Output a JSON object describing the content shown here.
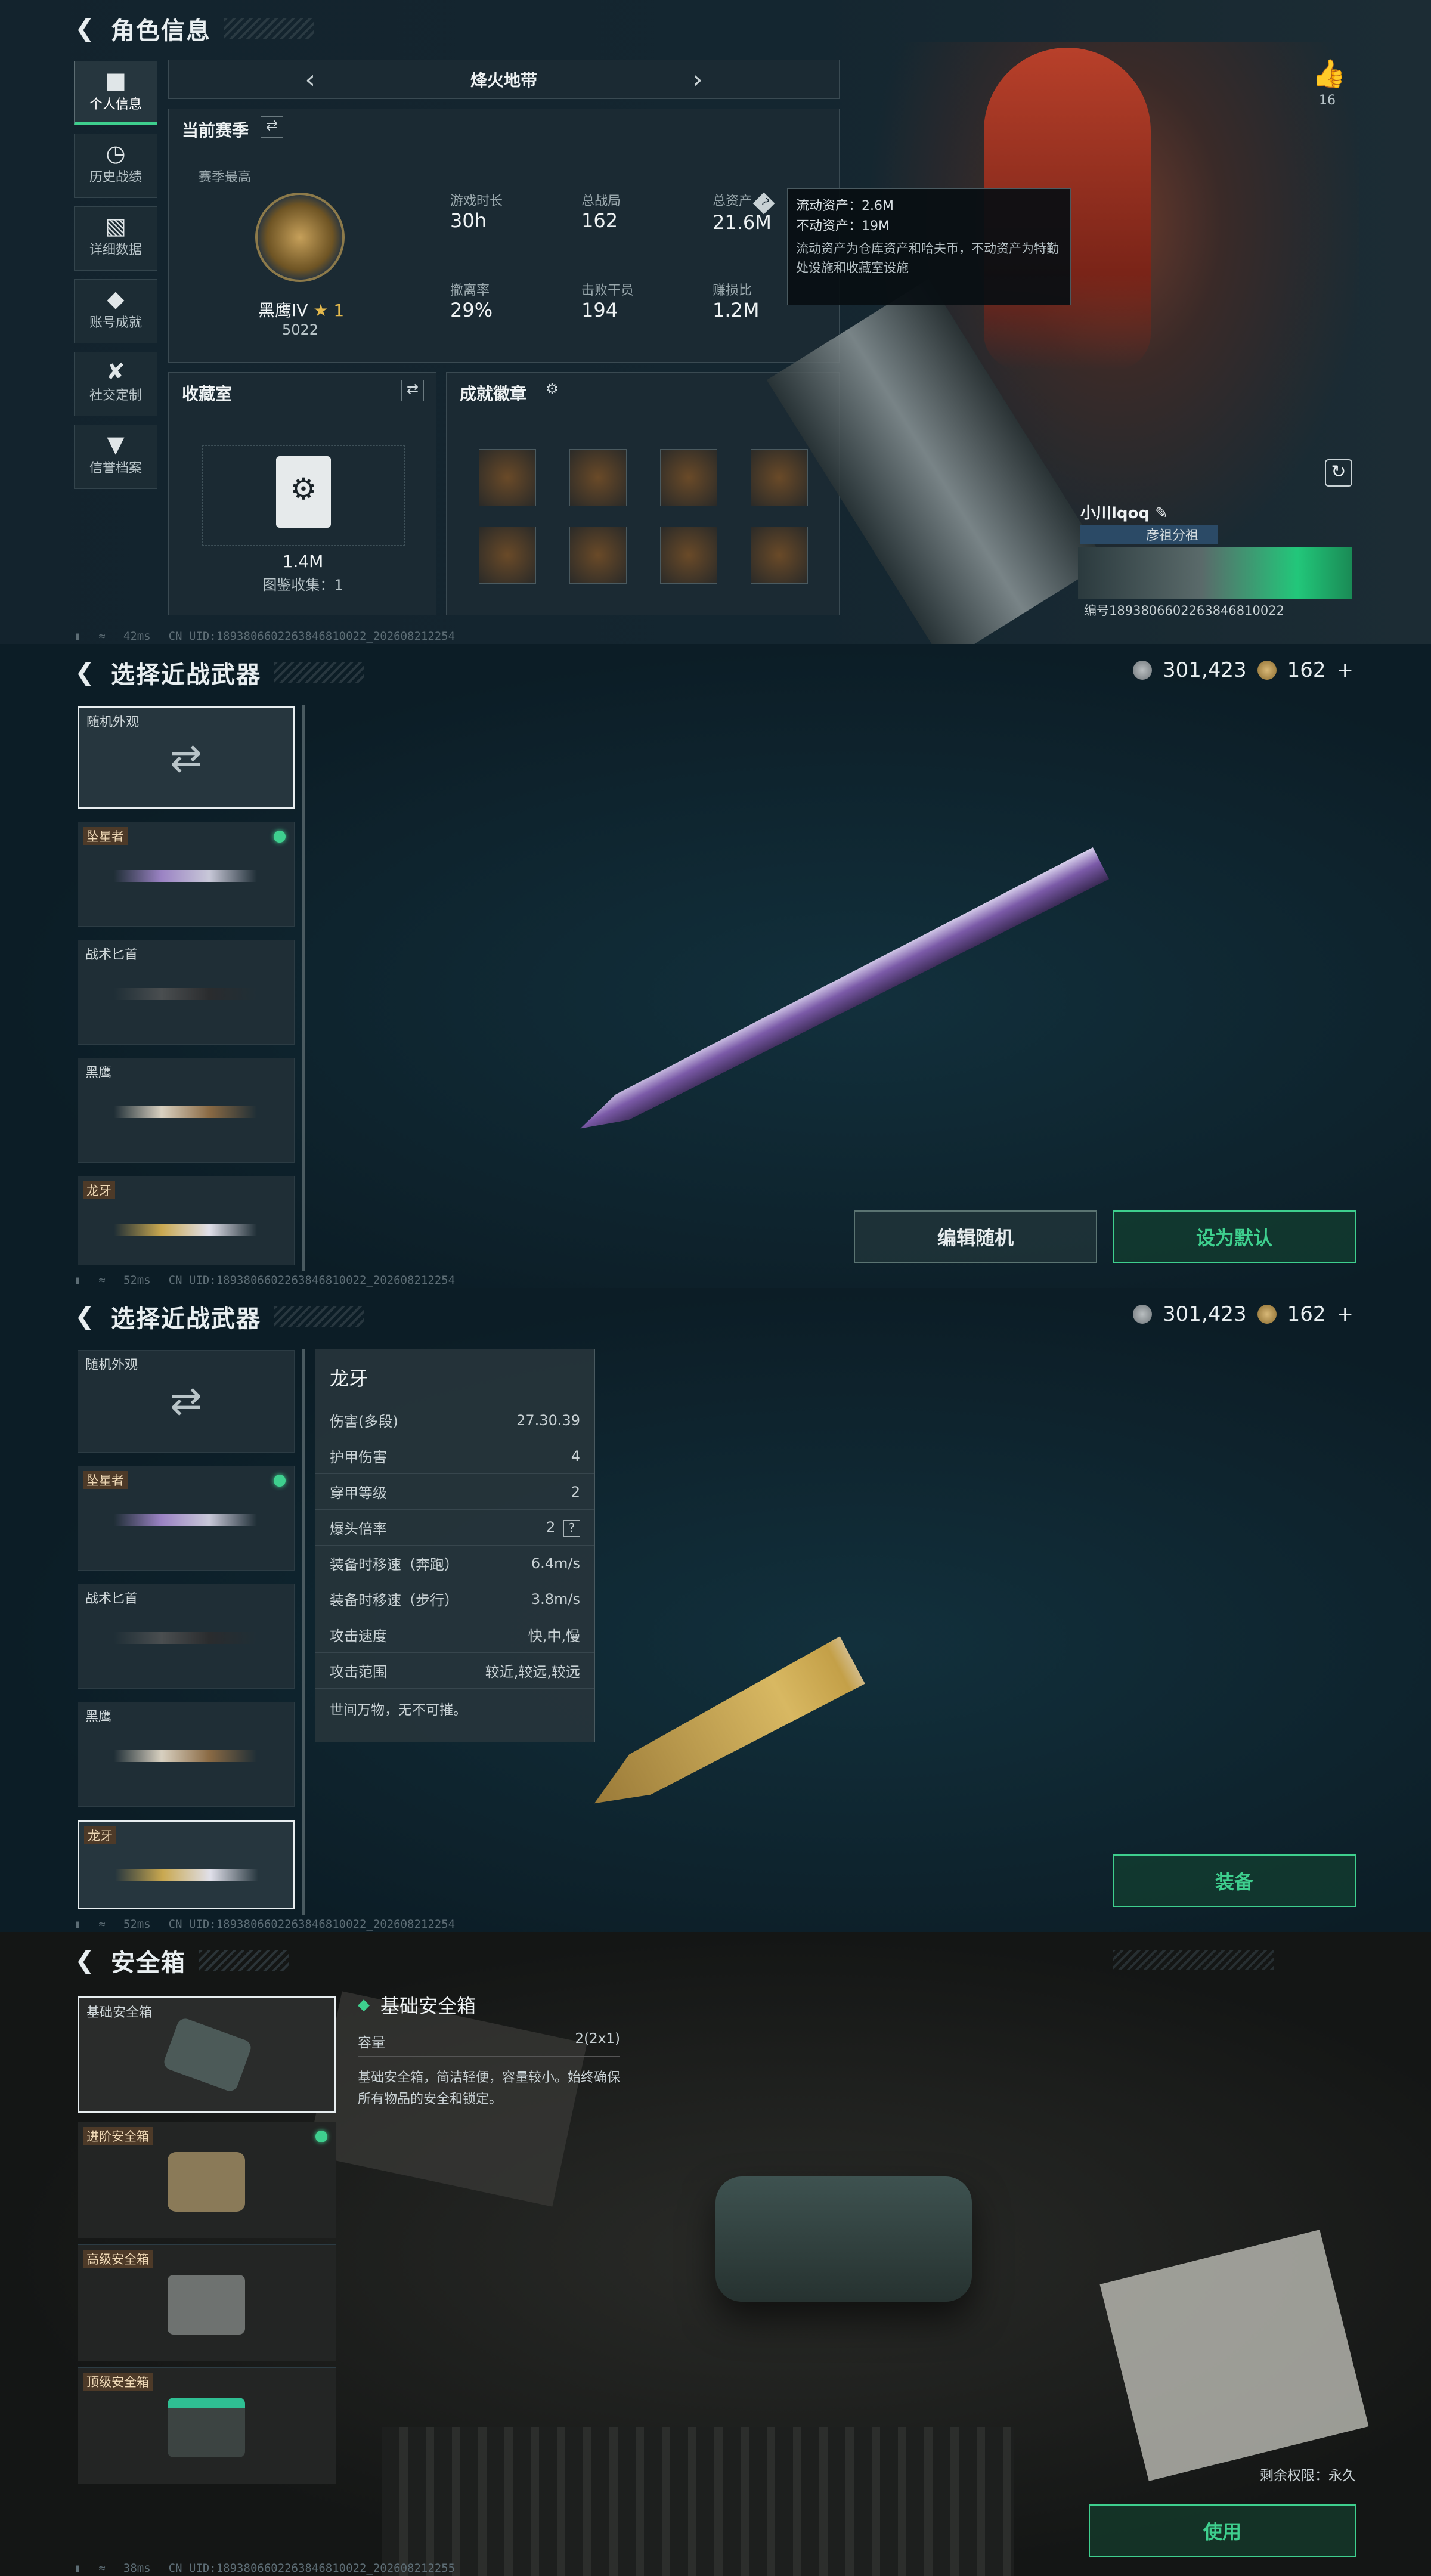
{
  "p1": {
    "title": "角色信息",
    "sidebar": [
      {
        "icon": "bar-chart-icon",
        "label": "个人信息"
      },
      {
        "icon": "history-icon",
        "label": "历史战绩"
      },
      {
        "icon": "folder-icon",
        "label": "详细数据"
      },
      {
        "icon": "trophy-icon",
        "label": "账号成就"
      },
      {
        "icon": "wrench-icon",
        "label": "社交定制"
      },
      {
        "icon": "shield-icon",
        "label": "信誉档案"
      }
    ],
    "map": "烽火地带",
    "season_label": "当前赛季",
    "season_best": "赛季最高",
    "rank_name": "黑鹰IV",
    "rank_stars": "★ 1",
    "rank_points": "5022",
    "stats": [
      {
        "label": "游戏时长",
        "value": "30h"
      },
      {
        "label": "总战局",
        "value": "162"
      },
      {
        "label": "总资产",
        "value": "21.6M"
      },
      {
        "label": "撤离率",
        "value": "29%"
      },
      {
        "label": "击败干员",
        "value": "194"
      },
      {
        "label": "赚损比",
        "value": "1.2M"
      }
    ],
    "tooltip": {
      "line1": "流动资产：2.6M",
      "line2": "不动资产：19M",
      "desc": "流动资产为仓库资产和哈夫币，不动资产为特勤处设施和收藏室设施"
    },
    "collection_title": "收藏室",
    "collection_value": "1.4M",
    "collection_count": "图鉴收集：1",
    "badges_title": "成就徽章",
    "likes": "16",
    "player_name": "小川lqoq",
    "player_group": "彦祖分祖",
    "player_id": "编号1893806602263846810022",
    "status_ping": "42ms",
    "uid": "CN UID:1893806602263846810022_202608212254"
  },
  "p2": {
    "title": "选择近战武器",
    "silver": "301,423",
    "gold": "162",
    "plus": "+",
    "random_label": "随机外观",
    "weapons": [
      {
        "name": "坠星者",
        "tag": true,
        "equipped": true
      },
      {
        "name": "战术匕首",
        "tag": false
      },
      {
        "name": "黑鹰",
        "tag": false
      },
      {
        "name": "龙牙",
        "tag": true
      }
    ],
    "btn_edit": "编辑随机",
    "btn_default": "设为默认",
    "status_ping": "52ms",
    "uid": "CN UID:1893806602263846810022_202608212254"
  },
  "p3": {
    "title": "选择近战武器",
    "silver": "301,423",
    "gold": "162",
    "plus": "+",
    "random_label": "随机外观",
    "weapons": [
      {
        "name": "坠星者",
        "tag": true,
        "equipped": true
      },
      {
        "name": "战术匕首",
        "tag": false
      },
      {
        "name": "黑鹰",
        "tag": false
      },
      {
        "name": "龙牙",
        "tag": true
      }
    ],
    "detail_name": "龙牙",
    "detail_stats": [
      {
        "label": "伤害(多段)",
        "value": "27.30.39"
      },
      {
        "label": "护甲伤害",
        "value": "4"
      },
      {
        "label": "穿甲等级",
        "value": "2"
      },
      {
        "label": "爆头倍率",
        "value": "2"
      },
      {
        "label": "装备时移速（奔跑）",
        "value": "6.4m/s"
      },
      {
        "label": "装备时移速（步行）",
        "value": "3.8m/s"
      },
      {
        "label": "攻击速度",
        "value": "快,中,慢"
      },
      {
        "label": "攻击范围",
        "value": "较近,较远,较远"
      }
    ],
    "detail_quote": "世间万物，无不可摧。",
    "btn_equip": "装备",
    "status_ping": "52ms",
    "uid": "CN UID:1893806602263846810022_202608212254"
  },
  "p4": {
    "title": "安全箱",
    "boxes": [
      {
        "name": "基础安全箱"
      },
      {
        "name": "进阶安全箱",
        "equipped": true
      },
      {
        "name": "高级安全箱"
      },
      {
        "name": "顶级安全箱"
      }
    ],
    "detail_name": "基础安全箱",
    "capacity_label": "容量",
    "capacity_value": "2(2x1)",
    "desc": "基础安全箱，简洁轻便，容量较小。始终确保所有物品的安全和锁定。",
    "remaining": "剩余权限：永久",
    "btn_use": "使用",
    "status_ping": "38ms",
    "uid": "CN UID:1893806602263846810022_202608212255"
  },
  "colors": {
    "accent": "#3ecf8e",
    "bg": "#13232d",
    "tag": "#4d3a28"
  }
}
